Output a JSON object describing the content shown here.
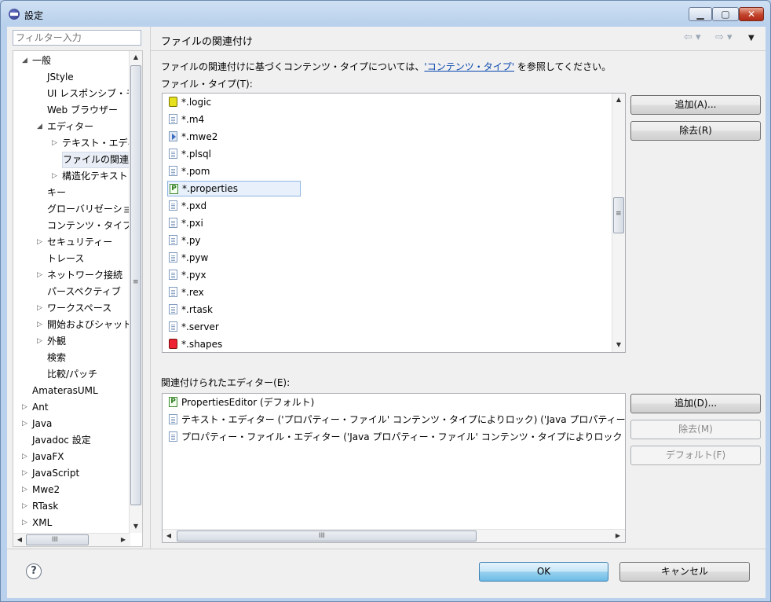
{
  "window": {
    "title": "設定",
    "minimize_glyph": "▁",
    "maximize_glyph": "▢",
    "close_glyph": "✕"
  },
  "filter": {
    "placeholder": "フィルター入力"
  },
  "tree": {
    "items": [
      {
        "label": "一般",
        "twisty": "◢",
        "indent": 0
      },
      {
        "label": "JStyle",
        "twisty": "",
        "indent": 1
      },
      {
        "label": "UI レスポンシブ・モ",
        "twisty": "",
        "indent": 1
      },
      {
        "label": "Web ブラウザー",
        "twisty": "",
        "indent": 1
      },
      {
        "label": "エディター",
        "twisty": "◢",
        "indent": 1
      },
      {
        "label": "テキスト・エディ",
        "twisty": "▷",
        "indent": 2
      },
      {
        "label": "ファイルの関連付",
        "twisty": "",
        "indent": 2
      },
      {
        "label": "構造化テキスト",
        "twisty": "▷",
        "indent": 2
      },
      {
        "label": "キー",
        "twisty": "",
        "indent": 1
      },
      {
        "label": "グローバリゼーショ",
        "twisty": "",
        "indent": 1
      },
      {
        "label": "コンテンツ・タイプ",
        "twisty": "",
        "indent": 1
      },
      {
        "label": "セキュリティー",
        "twisty": "▷",
        "indent": 1
      },
      {
        "label": "トレース",
        "twisty": "",
        "indent": 1
      },
      {
        "label": "ネットワーク接続",
        "twisty": "▷",
        "indent": 1
      },
      {
        "label": "パースペクティブ",
        "twisty": "",
        "indent": 1
      },
      {
        "label": "ワークスペース",
        "twisty": "▷",
        "indent": 1
      },
      {
        "label": "開始およびシャット",
        "twisty": "▷",
        "indent": 1
      },
      {
        "label": "外観",
        "twisty": "▷",
        "indent": 1
      },
      {
        "label": "検索",
        "twisty": "",
        "indent": 1
      },
      {
        "label": "比較/パッチ",
        "twisty": "",
        "indent": 1
      },
      {
        "label": "AmaterasUML",
        "twisty": "",
        "indent": 0
      },
      {
        "label": "Ant",
        "twisty": "▷",
        "indent": 0
      },
      {
        "label": "Java",
        "twisty": "▷",
        "indent": 0
      },
      {
        "label": "Javadoc 設定",
        "twisty": "",
        "indent": 0
      },
      {
        "label": "JavaFX",
        "twisty": "▷",
        "indent": 0
      },
      {
        "label": "JavaScript",
        "twisty": "▷",
        "indent": 0
      },
      {
        "label": "Mwe2",
        "twisty": "▷",
        "indent": 0
      },
      {
        "label": "RTask",
        "twisty": "▷",
        "indent": 0
      },
      {
        "label": "XML",
        "twisty": "▷",
        "indent": 0
      }
    ],
    "selected_index": 6
  },
  "page": {
    "title": "ファイルの関連付け",
    "nav_back": "⇦ ▾",
    "nav_forward": "⇨ ▾",
    "menu": "▼",
    "desc_before": "ファイルの関連付けに基づくコンテンツ・タイプについては、",
    "desc_link": "'コンテンツ・タイプ'",
    "desc_after": " を参照してください。",
    "file_types_label": "ファイル・タイプ(T):",
    "editors_label": "関連付けられたエディター(E):"
  },
  "file_types": [
    {
      "label": "*.logic",
      "icon": "logic-icon"
    },
    {
      "label": "*.m4",
      "icon": "document-icon"
    },
    {
      "label": "*.mwe2",
      "icon": "mwe2-icon"
    },
    {
      "label": "*.plsql",
      "icon": "document-icon"
    },
    {
      "label": "*.pom",
      "icon": "document-icon"
    },
    {
      "label": "*.properties",
      "icon": "properties-icon"
    },
    {
      "label": "*.pxd",
      "icon": "document-icon"
    },
    {
      "label": "*.pxi",
      "icon": "document-icon"
    },
    {
      "label": "*.py",
      "icon": "document-icon"
    },
    {
      "label": "*.pyw",
      "icon": "document-icon"
    },
    {
      "label": "*.pyx",
      "icon": "document-icon"
    },
    {
      "label": "*.rex",
      "icon": "document-icon"
    },
    {
      "label": "*.rtask",
      "icon": "document-icon"
    },
    {
      "label": "*.server",
      "icon": "document-icon"
    },
    {
      "label": "*.shapes",
      "icon": "shapes-icon"
    }
  ],
  "file_types_selected": 5,
  "editors": [
    {
      "label": "PropertiesEditor (デフォルト)",
      "icon": "properties-icon"
    },
    {
      "label": "テキスト・エディター ('プロパティー・ファイル' コンテンツ・タイプによりロック) ('Java プロパティー",
      "icon": "document-icon"
    },
    {
      "label": "プロパティー・ファイル・エディター ('Java プロパティー・ファイル' コンテンツ・タイプによりロック",
      "icon": "document-icon"
    }
  ],
  "buttons": {
    "add_file_type": "追加(A)...",
    "remove_file_type": "除去(R)",
    "add_editor": "追加(D)...",
    "remove_editor": "除去(M)",
    "default_editor": "デフォルト(F)",
    "ok": "OK",
    "cancel": "キャンセル",
    "help": "?"
  },
  "scroll": {
    "up": "▲",
    "down": "▼",
    "left": "◀",
    "right": "▶",
    "grip_v": "≡",
    "grip_h": "III"
  },
  "colors": {
    "link": "#0645ad",
    "selection": "#e8f1fb",
    "default_button": "#98d1ef"
  }
}
